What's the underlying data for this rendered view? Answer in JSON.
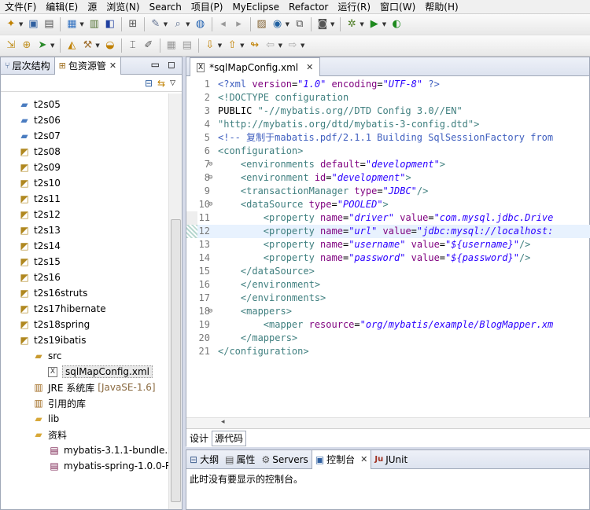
{
  "menu": [
    "文件(F)",
    "编辑(E)",
    "源",
    "浏览(N)",
    "Search",
    "项目(P)",
    "MyEclipse",
    "Refactor",
    "运行(R)",
    "窗口(W)",
    "帮助(H)"
  ],
  "left_panel": {
    "tabs": [
      "层次结构",
      "包资源管"
    ],
    "tree": [
      {
        "label": "t2s05",
        "icon": "project-folder",
        "indent": 1
      },
      {
        "label": "t2s06",
        "icon": "project-folder",
        "indent": 1
      },
      {
        "label": "t2s07",
        "icon": "project-folder",
        "indent": 1
      },
      {
        "label": "t2s08",
        "icon": "java-project",
        "indent": 1
      },
      {
        "label": "t2s09",
        "icon": "java-project",
        "indent": 1
      },
      {
        "label": "t2s10",
        "icon": "java-project",
        "indent": 1
      },
      {
        "label": "t2s11",
        "icon": "java-project",
        "indent": 1
      },
      {
        "label": "t2s12",
        "icon": "java-project",
        "indent": 1
      },
      {
        "label": "t2s13",
        "icon": "java-project",
        "indent": 1
      },
      {
        "label": "t2s14",
        "icon": "java-project",
        "indent": 1
      },
      {
        "label": "t2s15",
        "icon": "java-project",
        "indent": 1
      },
      {
        "label": "t2s16",
        "icon": "java-project",
        "indent": 1
      },
      {
        "label": "t2s16struts",
        "icon": "java-project",
        "indent": 1
      },
      {
        "label": "t2s17hibernate",
        "icon": "java-project",
        "indent": 1
      },
      {
        "label": "t2s18spring",
        "icon": "java-project",
        "indent": 1
      },
      {
        "label": "t2s19ibatis",
        "icon": "java-project",
        "indent": 1
      },
      {
        "label": "src",
        "icon": "source-folder",
        "indent": 2
      },
      {
        "label": "sqlMapConfig.xml",
        "icon": "xml-file",
        "indent": 3
      },
      {
        "label": "JRE 系统库",
        "suffix": "[JavaSE-1.6]",
        "icon": "library",
        "indent": 2
      },
      {
        "label": "引用的库",
        "icon": "library",
        "indent": 2
      },
      {
        "label": "lib",
        "icon": "folder",
        "indent": 2
      },
      {
        "label": "资料",
        "icon": "folder",
        "indent": 2
      },
      {
        "label": "mybatis-3.1.1-bundle.z",
        "icon": "archive",
        "indent": 3
      },
      {
        "label": "mybatis-spring-1.0.0-R",
        "icon": "archive",
        "indent": 3
      }
    ]
  },
  "editor": {
    "tab_title": "*sqlMapConfig.xml",
    "lines": [
      {
        "n": "1",
        "fold": "",
        "segs": [
          [
            "pi",
            "<?xml "
          ],
          [
            "attr",
            "version"
          ],
          [
            "plain",
            "="
          ],
          [
            "val",
            "\"1.0\""
          ],
          [
            "plain",
            " "
          ],
          [
            "attr",
            "encoding"
          ],
          [
            "plain",
            "="
          ],
          [
            "val",
            "\"UTF-8\""
          ],
          [
            "pi",
            " ?>"
          ]
        ]
      },
      {
        "n": "2",
        "fold": "",
        "segs": [
          [
            "dt",
            "<!DOCTYPE configuration"
          ]
        ]
      },
      {
        "n": "3",
        "fold": "",
        "segs": [
          [
            "plain",
            "PUBLIC "
          ],
          [
            "str",
            "\"-//mybatis.org//DTD Config 3.0//EN\""
          ]
        ]
      },
      {
        "n": "4",
        "fold": "",
        "segs": [
          [
            "str",
            "\"http://mybatis.org/dtd/mybatis-3-config.dtd\""
          ],
          [
            "dt",
            ">"
          ]
        ]
      },
      {
        "n": "5",
        "fold": "",
        "segs": [
          [
            "cm",
            "<!-- 复制于mabatis.pdf/2.1.1 Building SqlSessionFactory from"
          ]
        ]
      },
      {
        "n": "6",
        "fold": "",
        "segs": [
          [
            "tag",
            "<configuration>"
          ]
        ]
      },
      {
        "n": "7",
        "fold": "⊖",
        "segs": [
          [
            "plain",
            "    "
          ],
          [
            "tag",
            "<environments "
          ],
          [
            "attr",
            "default"
          ],
          [
            "plain",
            "="
          ],
          [
            "val",
            "\"development\""
          ],
          [
            "tag",
            ">"
          ]
        ]
      },
      {
        "n": "8",
        "fold": "⊖",
        "segs": [
          [
            "plain",
            "    "
          ],
          [
            "tag",
            "<environment "
          ],
          [
            "attr",
            "id"
          ],
          [
            "plain",
            "="
          ],
          [
            "val",
            "\"development\""
          ],
          [
            "tag",
            ">"
          ]
        ]
      },
      {
        "n": "9",
        "fold": "",
        "segs": [
          [
            "plain",
            "    "
          ],
          [
            "tag",
            "<transactionManager "
          ],
          [
            "attr",
            "type"
          ],
          [
            "plain",
            "="
          ],
          [
            "val",
            "\"JDBC\""
          ],
          [
            "tag",
            "/>"
          ]
        ]
      },
      {
        "n": "10",
        "fold": "⊖",
        "segs": [
          [
            "plain",
            "    "
          ],
          [
            "tag",
            "<dataSource "
          ],
          [
            "attr",
            "type"
          ],
          [
            "plain",
            "="
          ],
          [
            "val",
            "\"POOLED\""
          ],
          [
            "tag",
            ">"
          ]
        ]
      },
      {
        "n": "11",
        "fold": "",
        "segs": [
          [
            "plain",
            "        "
          ],
          [
            "tag",
            "<property "
          ],
          [
            "attr",
            "name"
          ],
          [
            "plain",
            "="
          ],
          [
            "val",
            "\"driver\""
          ],
          [
            "plain",
            " "
          ],
          [
            "attr",
            "value"
          ],
          [
            "plain",
            "="
          ],
          [
            "val",
            "\"com.mysql.jdbc.Drive"
          ]
        ]
      },
      {
        "n": "12",
        "fold": "",
        "segs": [
          [
            "plain",
            "        "
          ],
          [
            "tag",
            "<property "
          ],
          [
            "attr",
            "name"
          ],
          [
            "plain",
            "="
          ],
          [
            "val",
            "\"url\""
          ],
          [
            "plain",
            " "
          ],
          [
            "attr",
            "value"
          ],
          [
            "plain",
            "="
          ],
          [
            "val",
            "\"jdbc:mysql://localhost:"
          ]
        ]
      },
      {
        "n": "13",
        "fold": "",
        "segs": [
          [
            "plain",
            "        "
          ],
          [
            "tag",
            "<property "
          ],
          [
            "attr",
            "name"
          ],
          [
            "plain",
            "="
          ],
          [
            "val",
            "\"username\""
          ],
          [
            "plain",
            " "
          ],
          [
            "attr",
            "value"
          ],
          [
            "plain",
            "="
          ],
          [
            "val",
            "\"${username}\""
          ],
          [
            "tag",
            "/>"
          ]
        ]
      },
      {
        "n": "14",
        "fold": "",
        "segs": [
          [
            "plain",
            "        "
          ],
          [
            "tag",
            "<property "
          ],
          [
            "attr",
            "name"
          ],
          [
            "plain",
            "="
          ],
          [
            "val",
            "\"password\""
          ],
          [
            "plain",
            " "
          ],
          [
            "attr",
            "value"
          ],
          [
            "plain",
            "="
          ],
          [
            "val",
            "\"${password}\""
          ],
          [
            "tag",
            "/>"
          ]
        ]
      },
      {
        "n": "15",
        "fold": "",
        "segs": [
          [
            "plain",
            "    "
          ],
          [
            "tag",
            "</dataSource>"
          ]
        ]
      },
      {
        "n": "16",
        "fold": "",
        "segs": [
          [
            "plain",
            "    "
          ],
          [
            "tag",
            "</environment>"
          ]
        ]
      },
      {
        "n": "17",
        "fold": "",
        "segs": [
          [
            "plain",
            "    "
          ],
          [
            "tag",
            "</environments>"
          ]
        ]
      },
      {
        "n": "18",
        "fold": "⊖",
        "segs": [
          [
            "plain",
            "    "
          ],
          [
            "tag",
            "<mappers>"
          ]
        ]
      },
      {
        "n": "19",
        "fold": "",
        "segs": [
          [
            "plain",
            "        "
          ],
          [
            "tag",
            "<mapper "
          ],
          [
            "attr",
            "resource"
          ],
          [
            "plain",
            "="
          ],
          [
            "val",
            "\"org/mybatis/example/BlogMapper.xm"
          ]
        ]
      },
      {
        "n": "20",
        "fold": "",
        "segs": [
          [
            "plain",
            "    "
          ],
          [
            "tag",
            "</mappers>"
          ]
        ]
      },
      {
        "n": "21",
        "fold": "",
        "segs": [
          [
            "tag",
            "</configuration>"
          ]
        ]
      }
    ],
    "bottom_tabs": [
      "设计",
      "源代码"
    ]
  },
  "bottom_panel": {
    "tabs": [
      "大纲",
      "属性",
      "Servers",
      "控制台",
      "JUnit"
    ],
    "message": "此时没有要显示的控制台。"
  }
}
